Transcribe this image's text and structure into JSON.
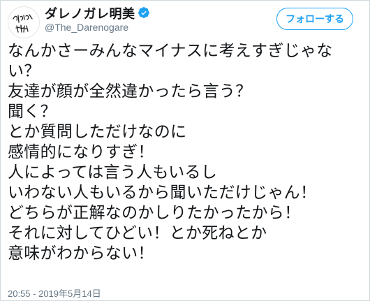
{
  "user": {
    "display_name": "ダレノガレ明美",
    "handle": "@The_Darenogare",
    "avatar_icon": "handwritten-signature-avatar",
    "verified_icon": "verified-badge-icon",
    "avatar_signature_lines": [
      "ダレノガレ",
      "明美"
    ]
  },
  "follow_button": {
    "label": "フォローする"
  },
  "tweet": {
    "lines": [
      "なんかさーみんなマイナスに考えすぎじゃな",
      "い？",
      "友達が顔が全然違かったら言う？",
      "聞く？",
      "とか質問しただけなのに",
      "感情的になりすぎ！",
      "人によっては言う人もいるし",
      "いわない人もいるから聞いただけじゃん！",
      "どちらが正解なのかしりたかったから！",
      "それに対してひどい！とか死ねとか",
      "意味がわからない！"
    ],
    "timestamp": "20:55 - 2019年5月14日"
  },
  "colors": {
    "accent": "#1da1f2",
    "secondary_text": "#657786",
    "primary_text": "#14171a"
  }
}
